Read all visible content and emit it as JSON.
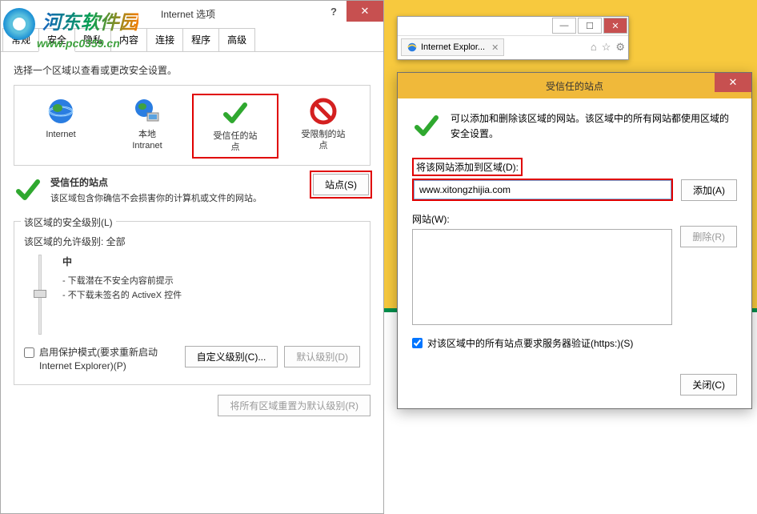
{
  "watermark": {
    "text": "河东软件园",
    "url": "www.pc0359.cn"
  },
  "options_dialog": {
    "title": "Internet 选项",
    "tabs": [
      "常规",
      "安全",
      "隐私",
      "内容",
      "连接",
      "程序",
      "高级"
    ],
    "active_tab_index": 1,
    "intro": "选择一个区域以查看或更改安全设置。",
    "zones": [
      {
        "label": "Internet"
      },
      {
        "label": "本地\nIntranet"
      },
      {
        "label": "受信任的站\n点"
      },
      {
        "label": "受限制的站\n点"
      }
    ],
    "selected_zone_index": 2,
    "zone_info": {
      "title": "受信任的站点",
      "desc": "该区域包含你确信不会损害你的计算机或文件的网站。",
      "sites_btn": "站点(S)"
    },
    "security_level": {
      "group_title": "该区域的安全级别(L)",
      "allowed": "该区域的允许级别: 全部",
      "level": "中",
      "desc1": "- 下载潜在不安全内容前提示",
      "desc2": "- 不下载未签名的 ActiveX 控件"
    },
    "protect_mode": "启用保护模式(要求重新启动 Internet Explorer)(P)",
    "custom_btn": "自定义级别(C)...",
    "default_btn": "默认级别(D)",
    "reset_btn": "将所有区域重置为默认级别(R)"
  },
  "browser": {
    "tab_title": "Internet Explor..."
  },
  "trusted_dialog": {
    "title": "受信任的站点",
    "intro": "可以添加和删除该区域的网站。该区域中的所有网站都使用区域的安全设置。",
    "add_label": "将该网站添加到区域(D):",
    "input_value": "www.xitongzhijia.com",
    "add_btn": "添加(A)",
    "list_label": "网站(W):",
    "remove_btn": "删除(R)",
    "https_check": "对该区域中的所有站点要求服务器验证(https:)(S)",
    "close_btn": "关闭(C)"
  }
}
